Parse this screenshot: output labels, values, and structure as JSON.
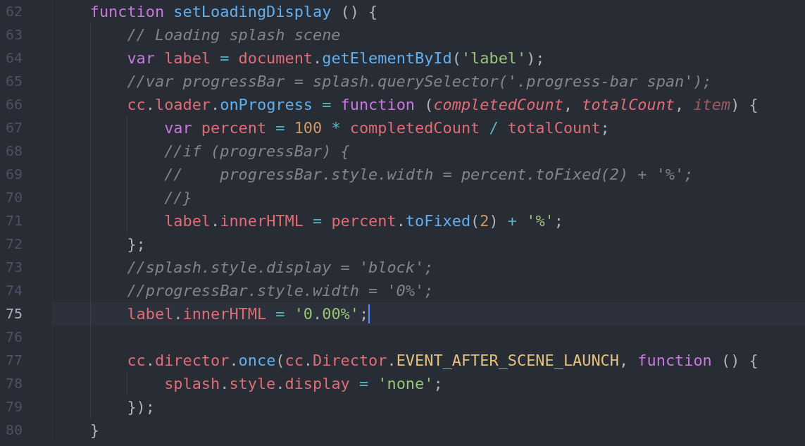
{
  "editor": {
    "lines": [
      {
        "number": "62",
        "current": false,
        "tokens": [
          {
            "kind": "keyword",
            "text": "function"
          },
          {
            "kind": "function",
            "text": " setLoadingDisplay"
          },
          {
            "kind": "punct",
            "text": " () {"
          }
        ],
        "children": [
          {
            "number": "63",
            "current": false,
            "tokens": [
              {
                "kind": "comment",
                "text": "// Loading splash scene"
              }
            ]
          },
          {
            "number": "64",
            "current": false,
            "tokens": [
              {
                "kind": "keyword",
                "text": "var"
              },
              {
                "kind": "variable",
                "text": " label"
              },
              {
                "kind": "operator",
                "text": " ="
              },
              {
                "kind": "variable",
                "text": " document"
              },
              {
                "kind": "punct",
                "text": "."
              },
              {
                "kind": "function",
                "text": "getElementById"
              },
              {
                "kind": "punct",
                "text": "("
              },
              {
                "kind": "string",
                "text": "'label'"
              },
              {
                "kind": "punct",
                "text": ");"
              }
            ]
          },
          {
            "number": "65",
            "current": false,
            "tokens": [
              {
                "kind": "comment",
                "text": "//var progressBar = splash.querySelector('.progress-bar span');"
              }
            ]
          },
          {
            "number": "66",
            "current": false,
            "tokens": [
              {
                "kind": "variable",
                "text": "cc"
              },
              {
                "kind": "punct",
                "text": "."
              },
              {
                "kind": "variable",
                "text": "loader"
              },
              {
                "kind": "punct",
                "text": "."
              },
              {
                "kind": "function",
                "text": "onProgress"
              },
              {
                "kind": "operator",
                "text": " ="
              },
              {
                "kind": "keyword",
                "text": " function"
              },
              {
                "kind": "punct",
                "text": " ("
              },
              {
                "kind": "param",
                "text": "completedCount"
              },
              {
                "kind": "punct",
                "text": ","
              },
              {
                "kind": "param",
                "text": " totalCount"
              },
              {
                "kind": "punct",
                "text": ","
              },
              {
                "kind": "unused",
                "text": " item"
              },
              {
                "kind": "punct",
                "text": ") {"
              }
            ],
            "children": [
              {
                "number": "67",
                "current": false,
                "tokens": [
                  {
                    "kind": "keyword",
                    "text": "var"
                  },
                  {
                    "kind": "variable",
                    "text": " percent"
                  },
                  {
                    "kind": "operator",
                    "text": " ="
                  },
                  {
                    "kind": "number",
                    "text": " 100"
                  },
                  {
                    "kind": "operator",
                    "text": " *"
                  },
                  {
                    "kind": "variable",
                    "text": " completedCount"
                  },
                  {
                    "kind": "operator",
                    "text": " /"
                  },
                  {
                    "kind": "variable",
                    "text": " totalCount"
                  },
                  {
                    "kind": "punct",
                    "text": ";"
                  }
                ]
              },
              {
                "number": "68",
                "current": false,
                "tokens": [
                  {
                    "kind": "comment",
                    "text": "//if (progressBar) {"
                  }
                ]
              },
              {
                "number": "69",
                "current": false,
                "tokens": [
                  {
                    "kind": "comment",
                    "text": "//    progressBar.style.width = percent.toFixed(2) + '%';"
                  }
                ]
              },
              {
                "number": "70",
                "current": false,
                "tokens": [
                  {
                    "kind": "comment",
                    "text": "//}"
                  }
                ]
              },
              {
                "number": "71",
                "current": false,
                "tokens": [
                  {
                    "kind": "variable",
                    "text": "label"
                  },
                  {
                    "kind": "punct",
                    "text": "."
                  },
                  {
                    "kind": "variable",
                    "text": "innerHTML"
                  },
                  {
                    "kind": "operator",
                    "text": " ="
                  },
                  {
                    "kind": "variable",
                    "text": " percent"
                  },
                  {
                    "kind": "punct",
                    "text": "."
                  },
                  {
                    "kind": "function",
                    "text": "toFixed"
                  },
                  {
                    "kind": "punct",
                    "text": "("
                  },
                  {
                    "kind": "number",
                    "text": "2"
                  },
                  {
                    "kind": "punct",
                    "text": ")"
                  },
                  {
                    "kind": "operator",
                    "text": " +"
                  },
                  {
                    "kind": "string",
                    "text": " '%'"
                  },
                  {
                    "kind": "punct",
                    "text": ";"
                  }
                ]
              }
            ]
          },
          {
            "number": "72",
            "current": false,
            "tokens": [
              {
                "kind": "punct",
                "text": "};"
              }
            ]
          },
          {
            "number": "73",
            "current": false,
            "tokens": [
              {
                "kind": "comment",
                "text": "//splash.style.display = 'block';"
              }
            ]
          },
          {
            "number": "74",
            "current": false,
            "tokens": [
              {
                "kind": "comment",
                "text": "//progressBar.style.width = '0%';"
              }
            ]
          },
          {
            "number": "75",
            "current": true,
            "tokens": [
              {
                "kind": "variable",
                "text": "label"
              },
              {
                "kind": "punct",
                "text": "."
              },
              {
                "kind": "variable",
                "text": "innerHTML"
              },
              {
                "kind": "operator",
                "text": " ="
              },
              {
                "kind": "string",
                "text": " '0.00%'"
              },
              {
                "kind": "punct",
                "text": ";"
              }
            ]
          },
          {
            "number": "76",
            "current": false
          },
          {
            "number": "77",
            "current": false,
            "tokens": [
              {
                "kind": "variable",
                "text": "cc"
              },
              {
                "kind": "punct",
                "text": "."
              },
              {
                "kind": "variable",
                "text": "director"
              },
              {
                "kind": "punct",
                "text": "."
              },
              {
                "kind": "function",
                "text": "once"
              },
              {
                "kind": "punct",
                "text": "("
              },
              {
                "kind": "variable",
                "text": "cc"
              },
              {
                "kind": "punct",
                "text": "."
              },
              {
                "kind": "variable",
                "text": "Director"
              },
              {
                "kind": "punct",
                "text": "."
              },
              {
                "kind": "constant",
                "text": "EVENT_AFTER_SCENE_LAUNCH"
              },
              {
                "kind": "punct",
                "text": ","
              },
              {
                "kind": "keyword",
                "text": " function"
              },
              {
                "kind": "punct",
                "text": " () {"
              }
            ],
            "children": [
              {
                "number": "78",
                "current": false,
                "tokens": [
                  {
                    "kind": "variable",
                    "text": "splash"
                  },
                  {
                    "kind": "punct",
                    "text": "."
                  },
                  {
                    "kind": "variable",
                    "text": "style"
                  },
                  {
                    "kind": "punct",
                    "text": "."
                  },
                  {
                    "kind": "variable",
                    "text": "display"
                  },
                  {
                    "kind": "operator",
                    "text": " ="
                  },
                  {
                    "kind": "string",
                    "text": " 'none'"
                  },
                  {
                    "kind": "punct",
                    "text": ";"
                  }
                ]
              }
            ]
          },
          {
            "number": "79",
            "current": false,
            "tokens": [
              {
                "kind": "punct",
                "text": "});"
              }
            ]
          }
        ]
      },
      {
        "number": "80",
        "current": false,
        "tokens": [
          {
            "kind": "punct",
            "text": "}"
          }
        ]
      }
    ]
  }
}
